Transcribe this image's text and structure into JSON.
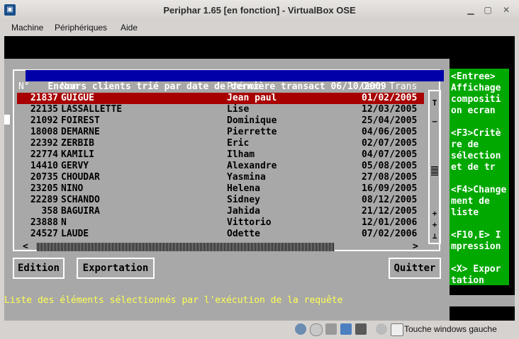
{
  "window": {
    "title": "Periphar 1.65 [en fonction] - VirtualBox OSE",
    "menu": [
      "Machine",
      "Périphériques",
      "Aide"
    ]
  },
  "app": {
    "header_title": "Encours clients trié par date de dernière transact 06/10/2009",
    "columns": {
      "num": "N°",
      "nom": "Nom",
      "prenom": "Prénom",
      "date": "Dern Trans"
    },
    "rows": [
      {
        "num": "21837",
        "nom": "GUIGUE",
        "prenom": "Jean paul",
        "date": "01/02/2005"
      },
      {
        "num": "22135",
        "nom": "LASSALLETTE",
        "prenom": "Lise",
        "date": "12/03/2005"
      },
      {
        "num": "21092",
        "nom": "FOIREST",
        "prenom": "Dominique",
        "date": "25/04/2005"
      },
      {
        "num": "18008",
        "nom": "DEMARNE",
        "prenom": "Pierrette",
        "date": "04/06/2005"
      },
      {
        "num": "22392",
        "nom": "ZERBIB",
        "prenom": "Eric",
        "date": "02/07/2005"
      },
      {
        "num": "22774",
        "nom": "KAMILI",
        "prenom": "Ilham",
        "date": "04/07/2005"
      },
      {
        "num": "14410",
        "nom": "GERVY",
        "prenom": "Alexandre",
        "date": "05/08/2005"
      },
      {
        "num": "20735",
        "nom": "CHOUDAR",
        "prenom": "Yasmina",
        "date": "27/08/2005"
      },
      {
        "num": "23205",
        "nom": "NINO",
        "prenom": "Helena",
        "date": "16/09/2005"
      },
      {
        "num": "22289",
        "nom": "SCHANDO",
        "prenom": "Sidney",
        "date": "08/12/2005"
      },
      {
        "num": "358",
        "nom": "BAGUIRA",
        "prenom": "Jahida",
        "date": "21/12/2005"
      },
      {
        "num": "23888",
        "nom": "N",
        "prenom": "Vittorio",
        "date": "12/01/2006"
      },
      {
        "num": "24527",
        "nom": "LAUDE",
        "prenom": "Odette",
        "date": "07/02/2006"
      }
    ],
    "selected_row": 0,
    "buttons": {
      "edition": "Edition",
      "exportation": "Exportation",
      "quitter": "Quitter"
    },
    "help": [
      "<Entree>",
      "Affichage",
      "compositi",
      "on ecran",
      "",
      "<F3>Critè",
      "re de",
      "sélection",
      "et de tr",
      "",
      "<F4>Change",
      "ment de",
      "liste",
      "",
      "<F10,E> I",
      "mpression",
      "",
      "<X> Expor",
      "tation"
    ],
    "status_line": "Liste des éléments sélectionnés par l'exécution de la requête",
    "scroll_glyphs": {
      "top": "T",
      "mid": "–",
      "up1": "+",
      "up2": "+",
      "bottom": "⊥",
      "left": "<",
      "right": ">"
    }
  },
  "vbox_status": {
    "host_key_label": "Touche windows gauche"
  }
}
